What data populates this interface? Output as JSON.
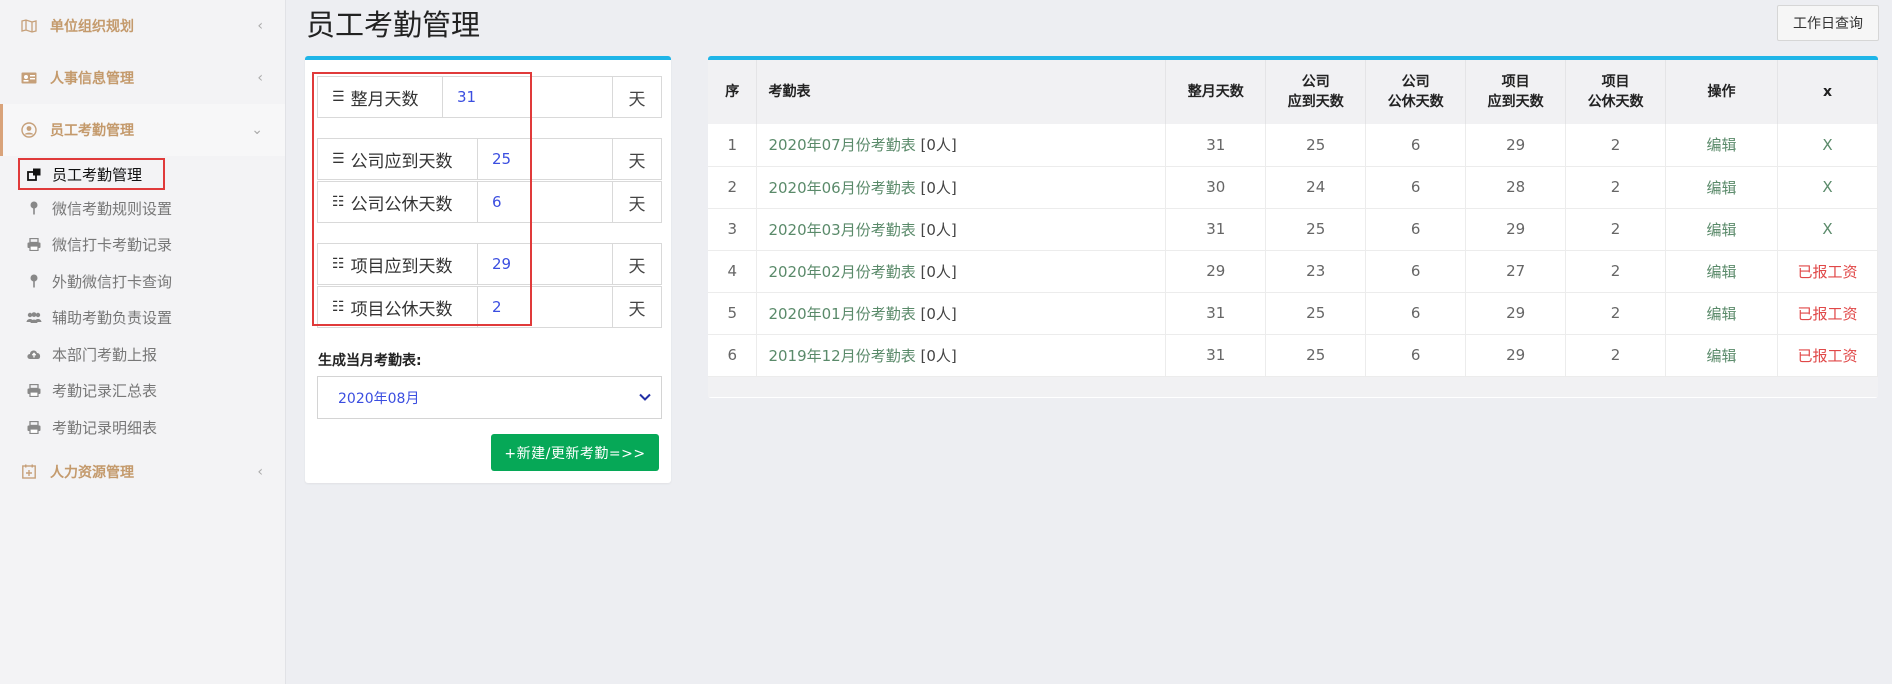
{
  "sidebar": {
    "groups": [
      {
        "label": "单位组织规划",
        "icon": "map-icon"
      },
      {
        "label": "人事信息管理",
        "icon": "id-card-icon"
      },
      {
        "label": "员工考勤管理",
        "icon": "user-circle-icon"
      },
      {
        "label": "人力资源管理",
        "icon": "calendar-plus-icon"
      }
    ],
    "sub_items": [
      {
        "label": "员工考勤管理",
        "icon": "external-link-icon"
      },
      {
        "label": "微信考勤规则设置",
        "icon": "pin-icon"
      },
      {
        "label": "微信打卡考勤记录",
        "icon": "printer-icon"
      },
      {
        "label": "外勤微信打卡查询",
        "icon": "pin-icon"
      },
      {
        "label": "辅助考勤负责设置",
        "icon": "users-icon"
      },
      {
        "label": "本部门考勤上报",
        "icon": "cloud-upload-icon"
      },
      {
        "label": "考勤记录汇总表",
        "icon": "printer-icon"
      },
      {
        "label": "考勤记录明细表",
        "icon": "printer-icon"
      }
    ]
  },
  "header": {
    "title": "员工考勤管理",
    "workday_button": "工作日查询"
  },
  "form": {
    "rows": [
      {
        "label": "整月天数",
        "value": "31",
        "unit": "天"
      },
      {
        "label": "公司应到天数",
        "value": "25",
        "unit": "天"
      },
      {
        "label": "公司公休天数",
        "value": "6",
        "unit": "天"
      },
      {
        "label": "项目应到天数",
        "value": "29",
        "unit": "天"
      },
      {
        "label": "项目公休天数",
        "value": "2",
        "unit": "天"
      }
    ],
    "gen_label": "生成当月考勤表:",
    "month_select": "2020年08月",
    "submit_button": "+新建/更新考勤=>>"
  },
  "table": {
    "headers": {
      "seq": "序",
      "name": "考勤表",
      "month_days": "整月天数",
      "co_due_1": "公司",
      "co_due_2": "应到天数",
      "co_off_1": "公司",
      "co_off_2": "公休天数",
      "pj_due_1": "项目",
      "pj_due_2": "应到天数",
      "pj_off_1": "项目",
      "pj_off_2": "公休天数",
      "op": "操作",
      "x": "x"
    },
    "rows": [
      {
        "seq": "1",
        "name": "2020年07月份考勤表",
        "count": "[0人]",
        "month_days": "31",
        "co_due": "25",
        "co_off": "6",
        "pj_due": "29",
        "pj_off": "2",
        "op": "编辑",
        "x": "X",
        "paid": false
      },
      {
        "seq": "2",
        "name": "2020年06月份考勤表",
        "count": "[0人]",
        "month_days": "30",
        "co_due": "24",
        "co_off": "6",
        "pj_due": "28",
        "pj_off": "2",
        "op": "编辑",
        "x": "X",
        "paid": false
      },
      {
        "seq": "3",
        "name": "2020年03月份考勤表",
        "count": "[0人]",
        "month_days": "31",
        "co_due": "25",
        "co_off": "6",
        "pj_due": "29",
        "pj_off": "2",
        "op": "编辑",
        "x": "X",
        "paid": false
      },
      {
        "seq": "4",
        "name": "2020年02月份考勤表",
        "count": "[0人]",
        "month_days": "29",
        "co_due": "23",
        "co_off": "6",
        "pj_due": "27",
        "pj_off": "2",
        "op": "编辑",
        "x": "已报工资",
        "paid": true
      },
      {
        "seq": "5",
        "name": "2020年01月份考勤表",
        "count": "[0人]",
        "month_days": "31",
        "co_due": "25",
        "co_off": "6",
        "pj_due": "29",
        "pj_off": "2",
        "op": "编辑",
        "x": "已报工资",
        "paid": true
      },
      {
        "seq": "6",
        "name": "2019年12月份考勤表",
        "count": "[0人]",
        "month_days": "31",
        "co_due": "25",
        "co_off": "6",
        "pj_due": "29",
        "pj_off": "2",
        "op": "编辑",
        "x": "已报工资",
        "paid": true
      }
    ]
  },
  "colors": {
    "accent_top": "#1fb5e8",
    "green_button": "#06a857",
    "highlight_red": "#e03a3a",
    "value_blue": "#3b4ee0",
    "link_green": "#5a8a6a",
    "paid_red": "#e04848",
    "group_tan": "#c49a6c"
  }
}
